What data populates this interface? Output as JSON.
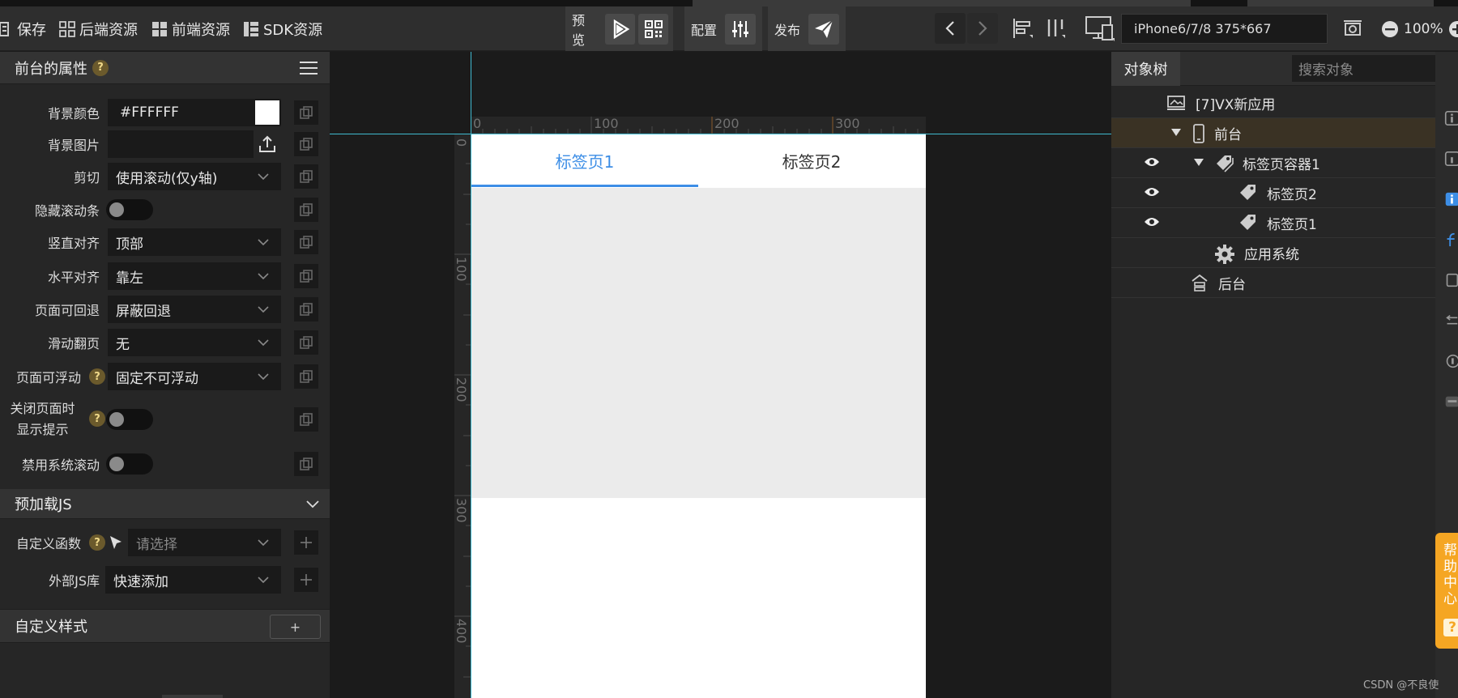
{
  "toolbar": {
    "save": "保存",
    "backend_resources": "后端资源",
    "frontend_resources": "前端资源",
    "sdk_resources": "SDK资源",
    "preview": "预览",
    "config": "配置",
    "publish": "发布",
    "device": "iPhone6/7/8 375*667",
    "zoom": "100%"
  },
  "left_panel": {
    "title": "前台的属性",
    "help_glyph": "?",
    "props": {
      "bg_color_label": "背景颜色",
      "bg_color_value": "#FFFFFF",
      "bg_image_label": "背景图片",
      "clip_label": "剪切",
      "clip_value": "使用滚动(仅y轴)",
      "hide_scrollbar_label": "隐藏滚动条",
      "valign_label": "竖直对齐",
      "valign_value": "顶部",
      "halign_label": "水平对齐",
      "halign_value": "靠左",
      "back_label": "页面可回退",
      "back_value": "屏蔽回退",
      "swipe_label": "滑动翻页",
      "swipe_value": "无",
      "float_label": "页面可浮动",
      "float_value": "固定不可浮动",
      "close_tip_label_1": "关闭页面时",
      "close_tip_label_2": "显示提示",
      "disable_scroll_label": "禁用系统滚动"
    },
    "preload_js": {
      "title": "预加载JS",
      "custom_func_label": "自定义函数",
      "custom_func_placeholder": "请选择",
      "external_js_label": "外部JS库",
      "external_js_value": "快速添加"
    },
    "custom_style": {
      "title": "自定义样式",
      "add": "+"
    }
  },
  "canvas": {
    "ruler_h": [
      "0",
      "100",
      "200",
      "300"
    ],
    "ruler_v": [
      "0",
      "100",
      "200",
      "300",
      "400"
    ],
    "tabs": [
      "标签页1",
      "标签页2"
    ],
    "active_tab": 0
  },
  "right_panel": {
    "tab": "对象树",
    "search_placeholder": "搜索对象",
    "tree": [
      {
        "label": "[7]VX新应用"
      },
      {
        "label": "前台"
      },
      {
        "label": "标签页容器1"
      },
      {
        "label": "标签页2"
      },
      {
        "label": "标签页1"
      },
      {
        "label": "应用系统"
      },
      {
        "label": "后台"
      }
    ]
  },
  "help_center": [
    "帮",
    "助",
    "中",
    "心"
  ],
  "help_center_glyph": "?",
  "credit": "CSDN @不良使",
  "colors": {
    "accent": "#3d8ee6",
    "guide": "#3fbad0",
    "help": "#f5a623"
  }
}
